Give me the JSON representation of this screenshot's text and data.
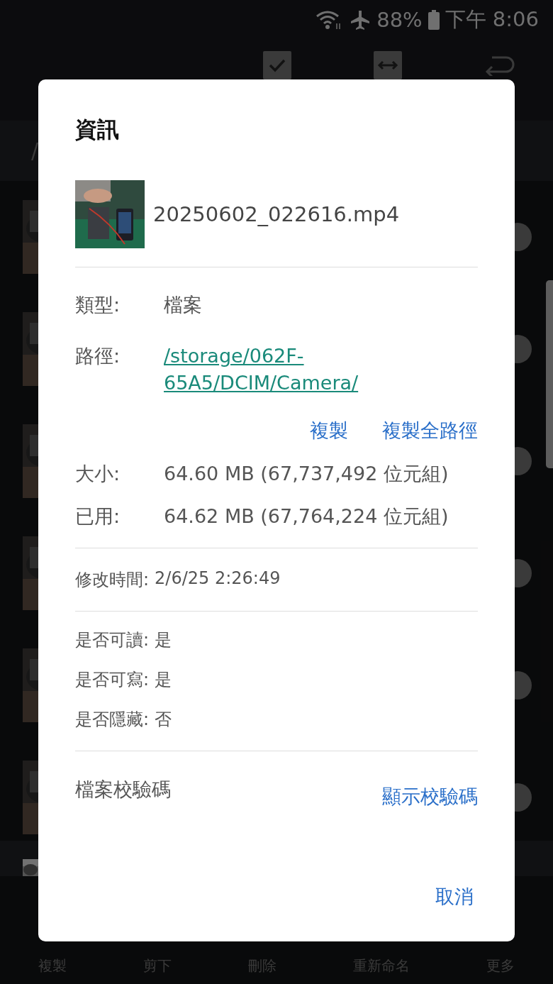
{
  "status_bar": {
    "battery": "88%",
    "time": "下午 8:06"
  },
  "breadcrumb": "/",
  "files": [
    {
      "kind": "picture"
    },
    {
      "kind": "picture"
    },
    {
      "kind": "picture"
    },
    {
      "kind": "picture"
    },
    {
      "kind": "picture"
    },
    {
      "kind": "picture"
    }
  ],
  "bottom_bar": [
    "複製",
    "剪下",
    "刪除",
    "重新命名",
    "更多"
  ],
  "dialog": {
    "title": "資訊",
    "file_name": "20250602_022616.mp4",
    "type": {
      "label": "類型:",
      "value": "檔案"
    },
    "path": {
      "label": "路徑:",
      "value": "/storage/062F-65A5/DCIM/Camera/"
    },
    "path_actions": [
      "複製",
      "複製全路徑"
    ],
    "sizes": [
      {
        "label": "大小:",
        "value": "64.60 MB (67,737,492 位元組)"
      },
      {
        "label": "已用:",
        "value": "64.62 MB (67,764,224 位元組)"
      }
    ],
    "modified": {
      "label": "修改時間:",
      "value": "2/6/25 2:26:49"
    },
    "attributes": [
      {
        "label": "是否可讀:",
        "value": "是"
      },
      {
        "label": "是否可寫:",
        "value": "是"
      },
      {
        "label": "是否隱藏:",
        "value": "否"
      }
    ],
    "checksum": {
      "label": "檔案校驗碼",
      "action": "顯示校驗碼"
    },
    "cancel": "取消"
  }
}
